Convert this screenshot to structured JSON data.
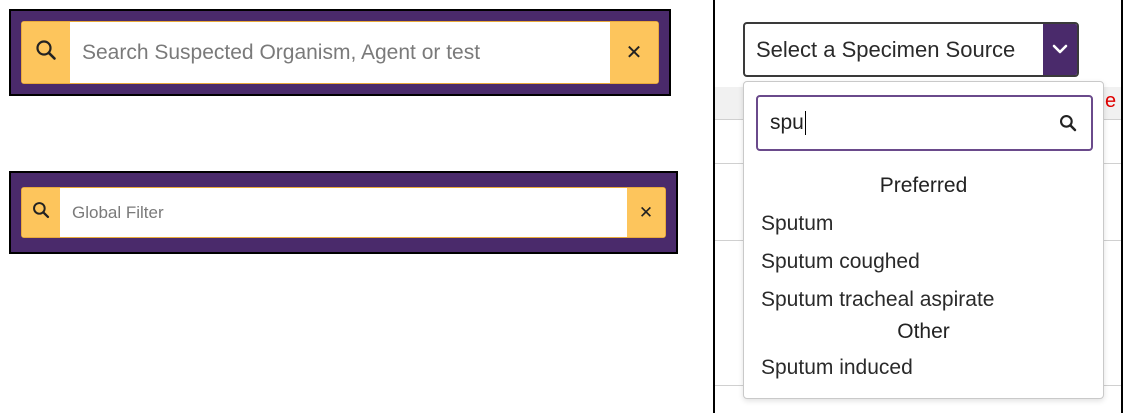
{
  "search1": {
    "placeholder": "Search Suspected Organism, Agent or test"
  },
  "search2": {
    "placeholder": "Global Filter"
  },
  "specimen_select": {
    "label": "Select a Specimen Source",
    "filter_value": "spu",
    "groups": [
      {
        "header": "Preferred",
        "options": [
          "Sputum",
          "Sputum coughed",
          "Sputum tracheal aspirate"
        ]
      },
      {
        "header": "Other",
        "options": [
          "Sputum induced"
        ]
      }
    ]
  },
  "hidden_text_fragment": "e",
  "colors": {
    "accent_purple": "#4a2a6b",
    "button_yellow": "#fdc55c",
    "input_border_orange": "#e8a93a",
    "filter_border_purple": "#6a4a8b",
    "required_red": "#e00000"
  },
  "icons": [
    "search-icon",
    "close-icon",
    "chevron-down-icon"
  ]
}
